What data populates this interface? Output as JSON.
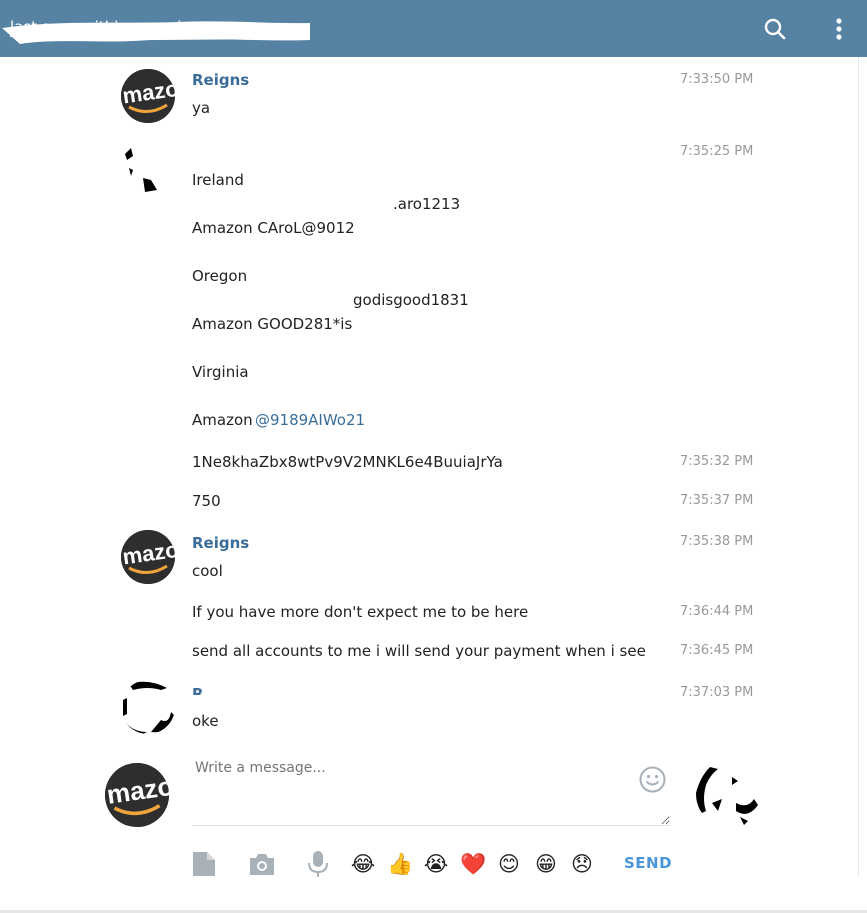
{
  "header": {
    "status": "last seen within a week",
    "search_icon": "search-icon",
    "more_icon": "more-vertical-icon"
  },
  "messages": [
    {
      "author": "Reigns",
      "text": "ya",
      "time": "7:33:50 PM"
    },
    {
      "time": "7:35:25 PM",
      "lines": [
        "Ireland",
        ".aro1213",
        "Amazon CAroL@9012",
        "Oregon",
        "godisgood1831",
        "Amazon GOOD281*is",
        "Virginia",
        "Amazon",
        "@9189AIWo21"
      ]
    },
    {
      "text": "1Ne8khaZbx8wtPv9V2MNKL6e4BuuiaJrYa",
      "time": "7:35:32 PM"
    },
    {
      "text": "750",
      "time": "7:35:37 PM"
    },
    {
      "author": "Reigns",
      "text": "cool",
      "time": "7:35:38 PM"
    },
    {
      "text": "If you have more don't expect me to be here",
      "time": "7:36:44 PM"
    },
    {
      "text": "send all accounts to me i will send your payment when i see",
      "time": "7:36:45 PM"
    },
    {
      "author": "R...",
      "text": "oke",
      "time": "7:37:03 PM"
    }
  ],
  "composer": {
    "placeholder": "Write a message...",
    "send_label": "SEND",
    "emojis": [
      "😂",
      "👍",
      "😭",
      "❤️",
      "😊",
      "😁",
      "😞"
    ]
  },
  "colors": {
    "header_bg": "#5682a3",
    "author": "#3a6d99",
    "send": "#4a95d6"
  }
}
